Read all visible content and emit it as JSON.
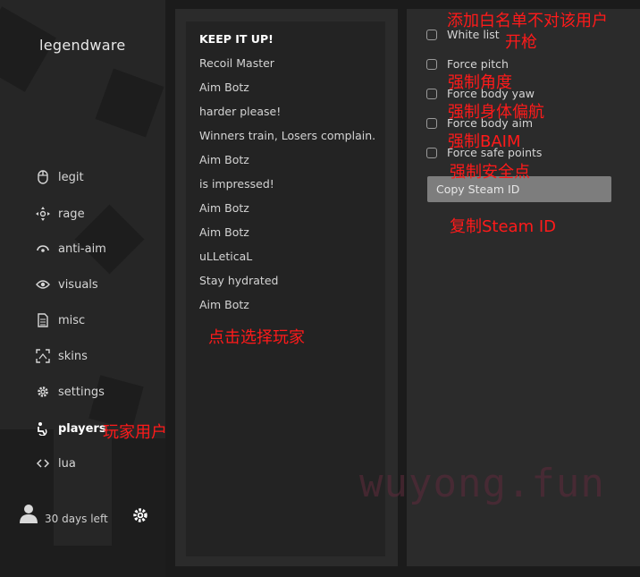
{
  "app": {
    "logo": "legendware"
  },
  "sidebar": {
    "items": [
      {
        "label": "legit",
        "icon": "mouse-icon"
      },
      {
        "label": "rage",
        "icon": "crosshair-icon"
      },
      {
        "label": "anti-aim",
        "icon": "anti-aim-icon"
      },
      {
        "label": "visuals",
        "icon": "eye-icon"
      },
      {
        "label": "misc",
        "icon": "document-icon"
      },
      {
        "label": "skins",
        "icon": "skins-icon"
      },
      {
        "label": "settings",
        "icon": "gear-icon"
      },
      {
        "label": "players",
        "icon": "players-icon",
        "active": true
      },
      {
        "label": "lua",
        "icon": "code-icon"
      }
    ],
    "subscription": "30 days left"
  },
  "players": {
    "list": [
      "KEEP IT UP!",
      "Recoil Master",
      "Aim Botz",
      "harder please!",
      "Winners train, Losers complain.",
      "Aim Botz",
      "is impressed!",
      "Aim Botz",
      "Aim Botz",
      "uLLeticaL",
      "Stay hydrated",
      "Aim Botz"
    ],
    "selected_index": 0
  },
  "options": {
    "checkboxes": [
      {
        "label": "White list",
        "checked": false
      },
      {
        "label": "Force pitch",
        "checked": false
      },
      {
        "label": "Force body yaw",
        "checked": false
      },
      {
        "label": "Force body aim",
        "checked": false
      },
      {
        "label": "Force safe points",
        "checked": false
      }
    ],
    "copy_button": "Copy Steam ID"
  },
  "annotations": {
    "whitelist_1": "添加白名单不对该用户",
    "whitelist_2": "开枪",
    "force_pitch": "强制角度",
    "body_yaw": "强制身体偏航",
    "baim": "强制BAIM",
    "safe_points": "强制安全点",
    "copy_id": "复制Steam ID",
    "select_player": "点击选择玩家",
    "players_user": "玩家用户"
  },
  "watermark": "wuyong.fun",
  "colors": {
    "annotation": "#ff1a1a",
    "panel": "#2b2b2b",
    "sidebar": "#262626",
    "button": "#7d7d7d"
  }
}
